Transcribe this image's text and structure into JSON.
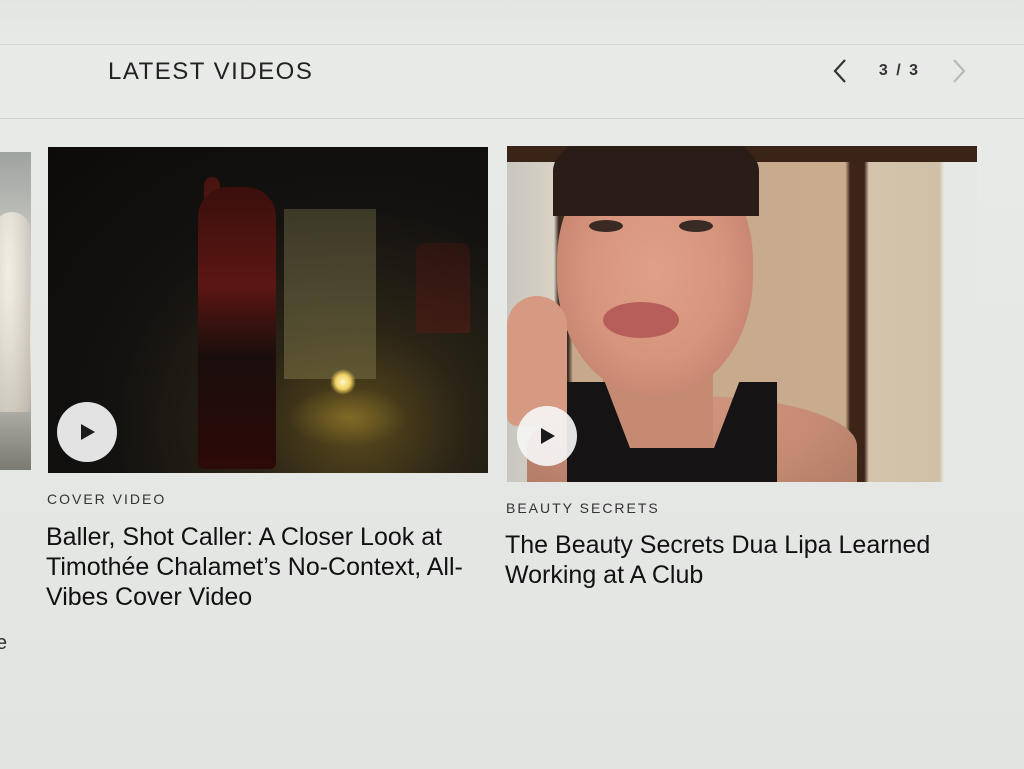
{
  "section": {
    "title": "LATEST VIDEOS"
  },
  "pager": {
    "counter": "3 / 3",
    "prev_icon": "chevron-left-icon",
    "next_icon": "chevron-right-icon"
  },
  "cards": [
    {
      "category": "COVER VIDEO",
      "headline": "Baller, Shot Caller: A Closer Look at Timothée Chalamet’s No-Context, All-Vibes Cover Video",
      "play_icon": "play-icon"
    },
    {
      "category": "BEAUTY SECRETS",
      "headline": "The Beauty Secrets Dua Lipa Learned Working at A Club",
      "play_icon": "play-icon"
    }
  ],
  "partial_text": "e",
  "colors": {
    "background": "#e6e8e6",
    "text": "#111111",
    "play_button": "#f5f5f5"
  }
}
